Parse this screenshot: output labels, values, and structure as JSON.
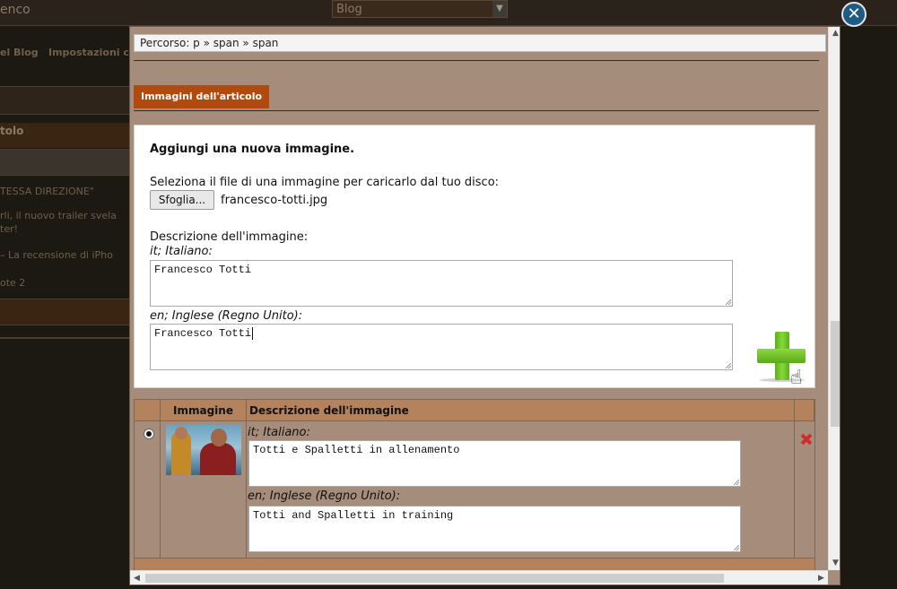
{
  "background": {
    "header_title": "enco",
    "select_value": "Blog",
    "nav_items": [
      "el Blog",
      "Impostazioni c"
    ],
    "section_title": "tolo",
    "rows": [
      "TESSA DIREZIONE\"",
      "rli, il nuovo trailer svela",
      "ter!",
      "– La recensione di iPho",
      "ote 2"
    ]
  },
  "modal": {
    "breadcrumb": "Percorso: p » span » span",
    "tab_label": "Immagini dell'articolo",
    "add": {
      "heading": "Aggiungi una nuova immagine.",
      "select_file_label": "Seleziona il file di una immagine per caricarlo dal tuo disco:",
      "browse_button": "Sfoglia...",
      "file_name": "francesco-totti.jpg",
      "description_label": "Descrizione dell'immagine:",
      "lang_it": "it; Italiano:",
      "desc_it": "Francesco Totti",
      "lang_en": "en; Inglese (Regno Unito):",
      "desc_en": "Francesco Totti"
    },
    "table": {
      "headers": [
        "Immagine",
        "Descrizione dell'immagine"
      ],
      "rows": [
        {
          "lang_it": "it; Italiano:",
          "desc_it": "Totti e Spalletti in allenamento",
          "lang_en": "en; Inglese (Regno Unito):",
          "desc_en": "Totti and Spalletti in training"
        }
      ]
    }
  },
  "icons": {
    "close": "close-icon",
    "add": "plus-icon",
    "delete": "delete-icon",
    "cursor": "hand-cursor-icon"
  },
  "colors": {
    "tab": "#b14a0e",
    "modal_bg": "#a68c7a",
    "table_header": "#b5825e",
    "close_button": "#1d5a86",
    "plus_green": "#6cc028",
    "delete_red": "#d42a2a"
  }
}
